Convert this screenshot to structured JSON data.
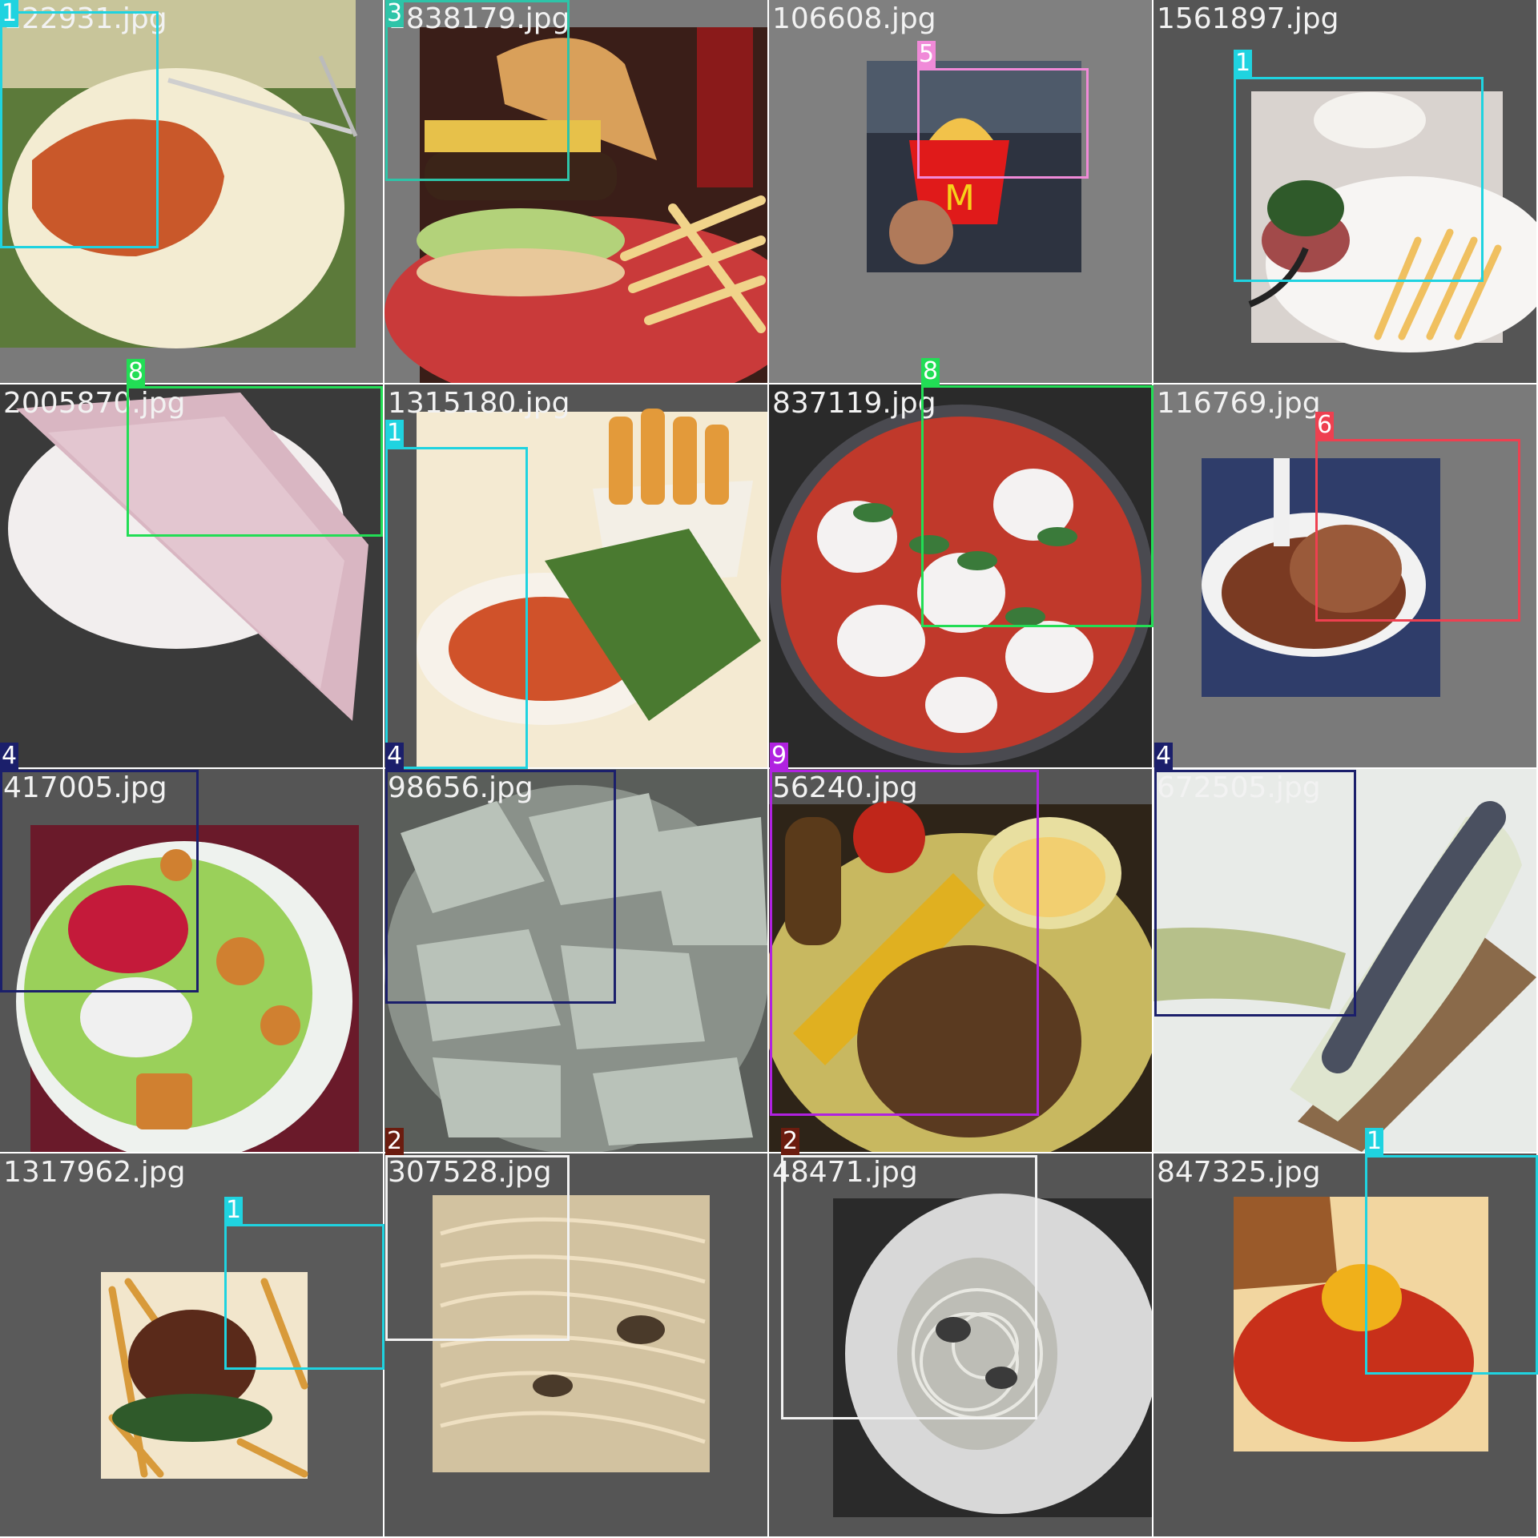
{
  "tiles": [
    {
      "filename": "122931.jpg",
      "depicts": "plate-flat-meat"
    },
    {
      "filename": "1838179.jpg",
      "depicts": "burger-fries"
    },
    {
      "filename": "106608.jpg",
      "depicts": "mcdonalds-fries"
    },
    {
      "filename": "1561897.jpg",
      "depicts": "tartare-fries"
    },
    {
      "filename": "2005870.jpg",
      "depicts": "pizza-slice"
    },
    {
      "filename": "1315180.jpg",
      "depicts": "wedges-salad"
    },
    {
      "filename": "837119.jpg",
      "depicts": "margherita-pizza"
    },
    {
      "filename": "116769.jpg",
      "depicts": "chocolate-gelato"
    },
    {
      "filename": "417005.jpg",
      "depicts": "caesar-salad"
    },
    {
      "filename": "98656.jpg",
      "depicts": "ravioli"
    },
    {
      "filename": "56240.jpg",
      "depicts": "steak-corn"
    },
    {
      "filename": "672505.jpg",
      "depicts": "sardine-toast"
    },
    {
      "filename": "1317962.jpg",
      "depicts": "burger-patty-fries"
    },
    {
      "filename": "307528.jpg",
      "depicts": "carbonara"
    },
    {
      "filename": "48471.jpg",
      "depicts": "spaghetti-plate"
    },
    {
      "filename": "847325.jpg",
      "depicts": "tartare-egg"
    }
  ],
  "labels": [
    {
      "tile": 0,
      "text": "1"
    },
    {
      "tile": 1,
      "text": "3"
    },
    {
      "tile": 2,
      "text": "5"
    },
    {
      "tile": 3,
      "text": "1"
    },
    {
      "tile": 4,
      "text": "8"
    },
    {
      "tile": 5,
      "text": "1"
    },
    {
      "tile": 6,
      "text": "8"
    },
    {
      "tile": 7,
      "text": "6"
    },
    {
      "tile": 8,
      "text": "4"
    },
    {
      "tile": 9,
      "text": "4"
    },
    {
      "tile": 10,
      "text": "9"
    },
    {
      "tile": 11,
      "text": "4"
    },
    {
      "tile": 12,
      "text": "1"
    },
    {
      "tile": 13,
      "text": "2"
    },
    {
      "tile": 14,
      "text": "2"
    },
    {
      "tile": 15,
      "text": "1"
    }
  ],
  "class_colors": {
    "1": "#1fd3e0",
    "2": "#6b1c0f",
    "3": "#2ec4a8",
    "4": "#1b1f6b",
    "5": "#f08ad8",
    "6": "#ee4050",
    "8": "#22dd55",
    "9": "#b022e0",
    "2-box": "#f2f2f2"
  }
}
